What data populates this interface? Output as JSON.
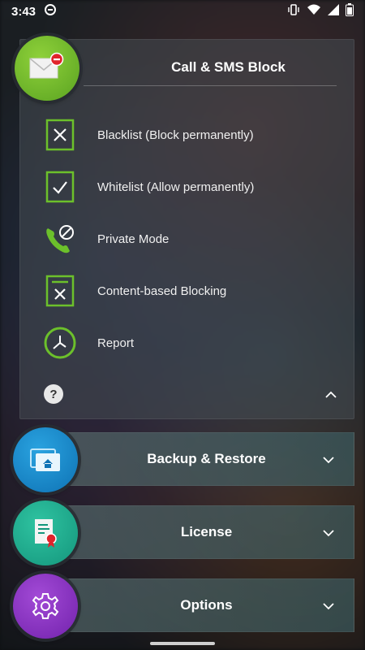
{
  "status_bar": {
    "time": "3:43"
  },
  "main_panel": {
    "title": "Call & SMS Block",
    "items": [
      {
        "label": "Blacklist (Block permanently)",
        "icon": "blacklist-x-icon"
      },
      {
        "label": "Whitelist (Allow permanently)",
        "icon": "whitelist-check-icon"
      },
      {
        "label": "Private Mode",
        "icon": "phone-blocked-icon"
      },
      {
        "label": "Content-based Blocking",
        "icon": "content-block-icon"
      },
      {
        "label": "Report",
        "icon": "clock-report-icon"
      }
    ],
    "help_label": "?"
  },
  "sections": [
    {
      "label": "Backup & Restore",
      "icon": "backup-restore-icon"
    },
    {
      "label": "License",
      "icon": "license-certificate-icon"
    },
    {
      "label": "Options",
      "icon": "gear-icon"
    }
  ],
  "colors": {
    "accent_green": "#6cc02b",
    "badge_red": "#e0242b"
  }
}
